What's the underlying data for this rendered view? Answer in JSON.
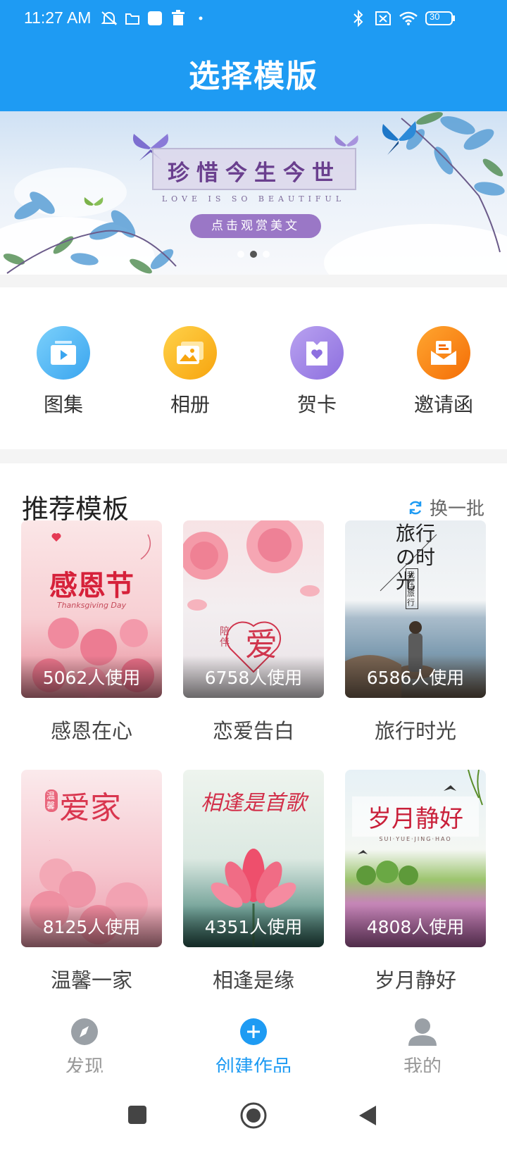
{
  "status_bar": {
    "time": "11:27 AM",
    "battery": "30"
  },
  "header": {
    "title": "选择模版"
  },
  "banner": {
    "title": "珍惜今生今世",
    "subtitle": "LOVE IS SO BEAUTIFUL",
    "button_label": "点击观赏美文",
    "page_count": 3,
    "active_page": 1
  },
  "categories": [
    {
      "label": "图集",
      "icon": "play-video-icon",
      "color": "#4fb6f3"
    },
    {
      "label": "相册",
      "icon": "photo-album-icon",
      "color": "#fbb21c"
    },
    {
      "label": "贺卡",
      "icon": "greeting-card-icon",
      "color": "#9f83e6"
    },
    {
      "label": "邀请函",
      "icon": "invitation-envelope-icon",
      "color": "#fb8c10"
    }
  ],
  "recommend": {
    "title": "推荐模板",
    "refresh_label": "换一批",
    "templates": [
      {
        "name": "感恩在心",
        "usage": "5062人使用",
        "art_text": "感恩节",
        "art_sub": "Thanksgiving Day"
      },
      {
        "name": "恋爱告白",
        "usage": "6758人使用",
        "art_text": "爱",
        "art_sub": "陪伴"
      },
      {
        "name": "旅行时光",
        "usage": "6586人使用",
        "art_text": "旅行の时光",
        "art_sub": "我在旅行"
      },
      {
        "name": "温馨一家",
        "usage": "8125人使用",
        "art_text": "爱家",
        "art_sub": "温馨"
      },
      {
        "name": "相逢是缘",
        "usage": "4351人使用",
        "art_text": "相逢是首歌",
        "art_sub": ""
      },
      {
        "name": "岁月静好",
        "usage": "4808人使用",
        "art_text": "岁月静好",
        "art_sub": "SUI·YUE·JING·HAO"
      }
    ]
  },
  "bottom_nav": [
    {
      "label": "发现",
      "icon": "compass-icon",
      "active": false
    },
    {
      "label": "创建作品",
      "icon": "plus-circle-icon",
      "active": true
    },
    {
      "label": "我的",
      "icon": "user-icon",
      "active": false
    }
  ],
  "colors": {
    "primary": "#1e9bf3",
    "inactive": "#999999"
  }
}
